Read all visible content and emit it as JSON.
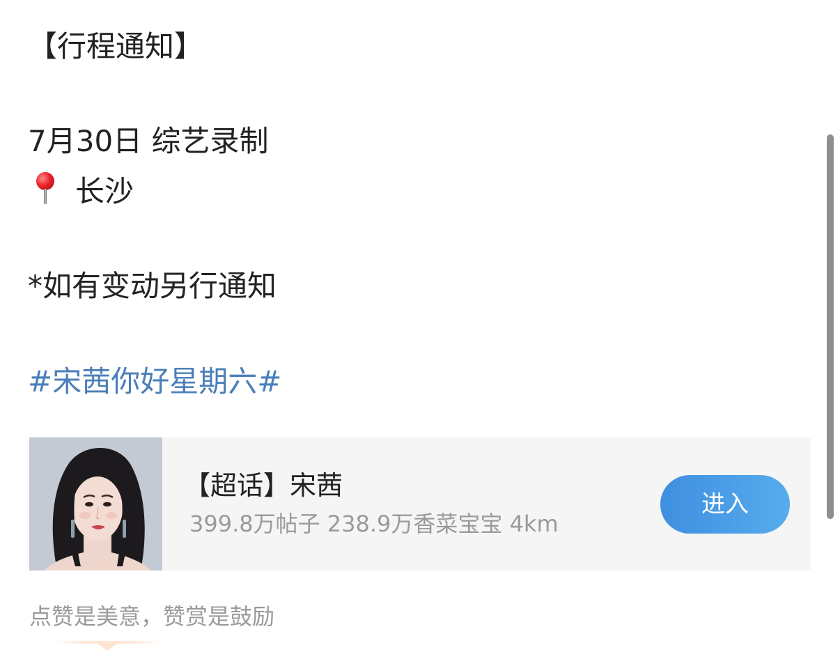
{
  "post": {
    "title": "【行程通知】",
    "date_line": "7月30日 综艺录制",
    "location": "长沙",
    "location_icon": "round-pushpin-icon",
    "note": "*如有变动另行通知",
    "hashtag": "#宋茜你好星期六#"
  },
  "supertopic_card": {
    "title": "【超话】宋茜",
    "stats": "399.8万帖子 238.9万香菜宝宝 4km",
    "enter_label": "进入",
    "enter_color": "#4a9be6"
  },
  "footer": {
    "reward_prompt": "点赞是美意，赞赏是鼓励"
  },
  "colors": {
    "hashtag": "#4a7fb8",
    "muted_text": "#9a9a9a",
    "card_bg": "#f5f5f5"
  }
}
